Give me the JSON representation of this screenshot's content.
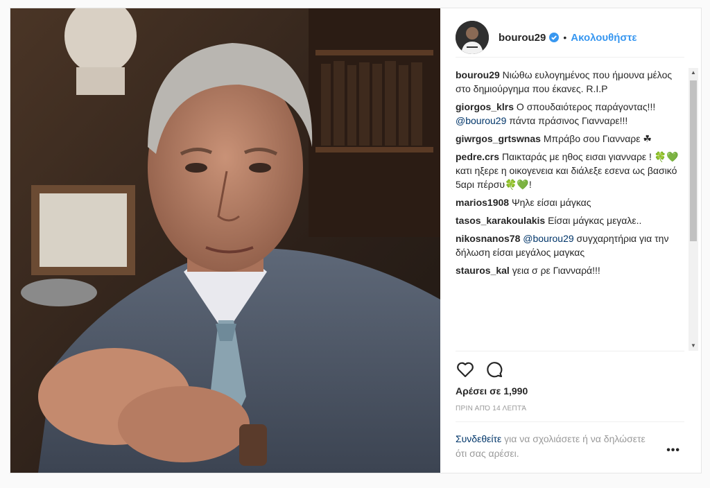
{
  "post": {
    "username": "bourou29",
    "verified": true,
    "follow_label": "Ακολουθήστε",
    "separator": "•"
  },
  "comments": [
    {
      "user": "bourou29",
      "parts": [
        {
          "t": "Νιώθω ευλογημένος που ήμουνα μέλος στο δημιούργημα που έκανες. R.I.P"
        }
      ]
    },
    {
      "user": "giorgos_klrs",
      "parts": [
        {
          "t": "Ο σπουδαιότερος παράγοντας!!! "
        },
        {
          "t": "@bourou29",
          "m": true
        },
        {
          "t": " πάντα πράσινος Γιανναρε!!!"
        }
      ]
    },
    {
      "user": "giwrgos_grtswnas",
      "parts": [
        {
          "t": "Μπράβο σου Γιανναρε ☘"
        }
      ]
    },
    {
      "user": "pedre.crs",
      "parts": [
        {
          "t": "Παικταράς με ηθος εισαι γιανναρε ! 🍀💚 κατι ηξερε η οικογενεια και διάλεξε εσενα ως βασικό 5αρι πέρσυ🍀💚!"
        }
      ]
    },
    {
      "user": "marios1908",
      "parts": [
        {
          "t": "Ψηλε είσαι μάγκας"
        }
      ]
    },
    {
      "user": "tasos_karakoulakis",
      "parts": [
        {
          "t": "Είσαι μάγκας μεγαλε.."
        }
      ]
    },
    {
      "user": "nikosnanos78",
      "parts": [
        {
          "t": "@bourou29",
          "m": true
        },
        {
          "t": " συγχαρητήρια για την δήλωση είσαι μεγάλος μαγκας"
        }
      ]
    },
    {
      "user": "stauros_kal",
      "parts": [
        {
          "t": "γεια σ ρε Γιανναρά!!!"
        }
      ]
    }
  ],
  "likes_text": "Αρέσει σε 1,990",
  "time_text": "ΠΡΙΝ ΑΠΌ 14 ΛΕΠΤΆ",
  "login": {
    "link": "Συνδεθείτε",
    "rest": " για να σχολιάσετε ή να δηλώσετε ότι σας αρέσει."
  },
  "more_label": "•••",
  "colors": {
    "accent": "#3897f0",
    "mention": "#003569",
    "muted": "#999999"
  }
}
